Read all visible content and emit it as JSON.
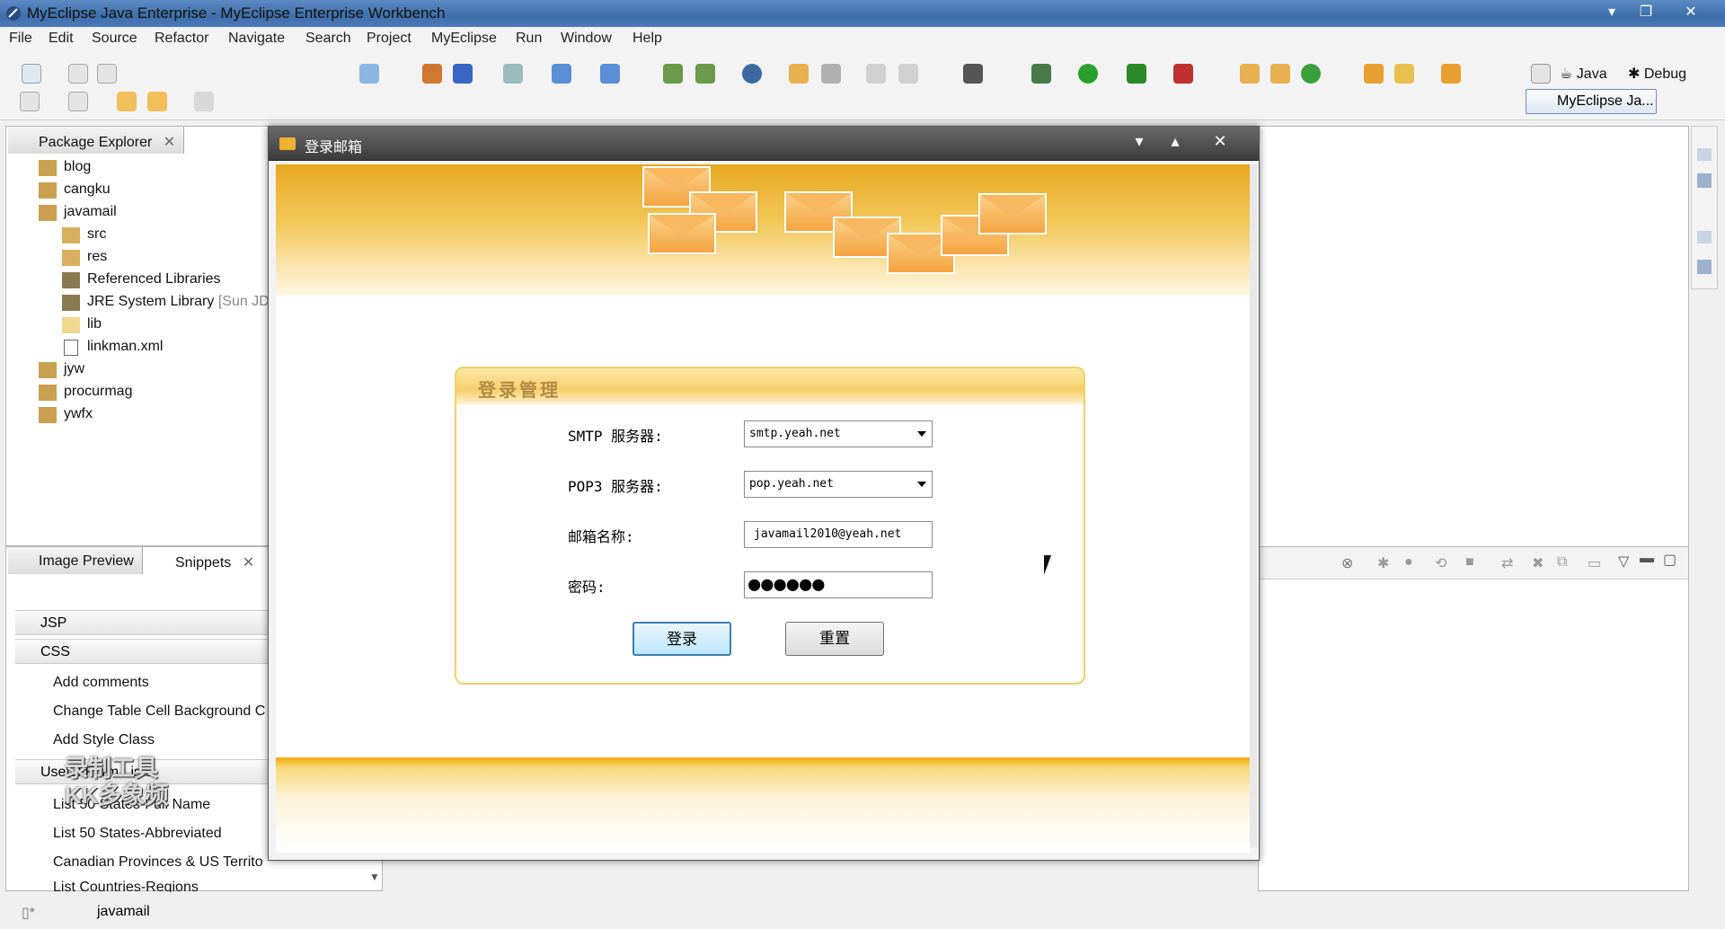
{
  "window": {
    "title": "MyEclipse Java Enterprise - MyEclipse Enterprise Workbench"
  },
  "menu": [
    "File",
    "Edit",
    "Source",
    "Refactor",
    "Navigate",
    "Search",
    "Project",
    "MyEclipse",
    "Run",
    "Window",
    "Help"
  ],
  "perspectives": {
    "java": "Java",
    "debug": "Debug",
    "active": "MyEclipse Ja..."
  },
  "package_explorer": {
    "tab": "Package Explorer",
    "items": [
      "blog",
      "cangku",
      "javamail",
      "src",
      "res",
      "Referenced Libraries",
      "JRE System Library",
      "[Sun JD",
      "lib",
      "linkman.xml",
      "jyw",
      "procurmag",
      "ywfx"
    ]
  },
  "lower_left": {
    "tab_image": "Image Preview",
    "tab_snippets": "Snippets",
    "categories": [
      "JSP",
      "CSS",
      "Useful Form Lists"
    ],
    "css_items": [
      "Add comments",
      "Change Table Cell Background C",
      "Add Style Class"
    ],
    "form_items": [
      "List 50 States-Full Name",
      "List 50 States-Abbreviated",
      "Canadian Provinces & US Territo",
      "List Countries-Regions"
    ]
  },
  "status": {
    "selected": "javamail"
  },
  "dialog": {
    "title": "登录邮箱",
    "box_title": "登录管理",
    "smtp_label": "SMTP 服务器:",
    "smtp_value": "smtp.yeah.net",
    "pop3_label": "POP3 服务器:",
    "pop3_value": "pop.yeah.net",
    "email_label": "邮箱名称:",
    "email_value": "javamail2010@yeah.net",
    "password_label": "密码:",
    "password_value": "●●●●●●",
    "login_button": "登录",
    "reset_button": "重置"
  },
  "watermark": {
    "line1": "录制工具",
    "line2": "KK多象频"
  }
}
